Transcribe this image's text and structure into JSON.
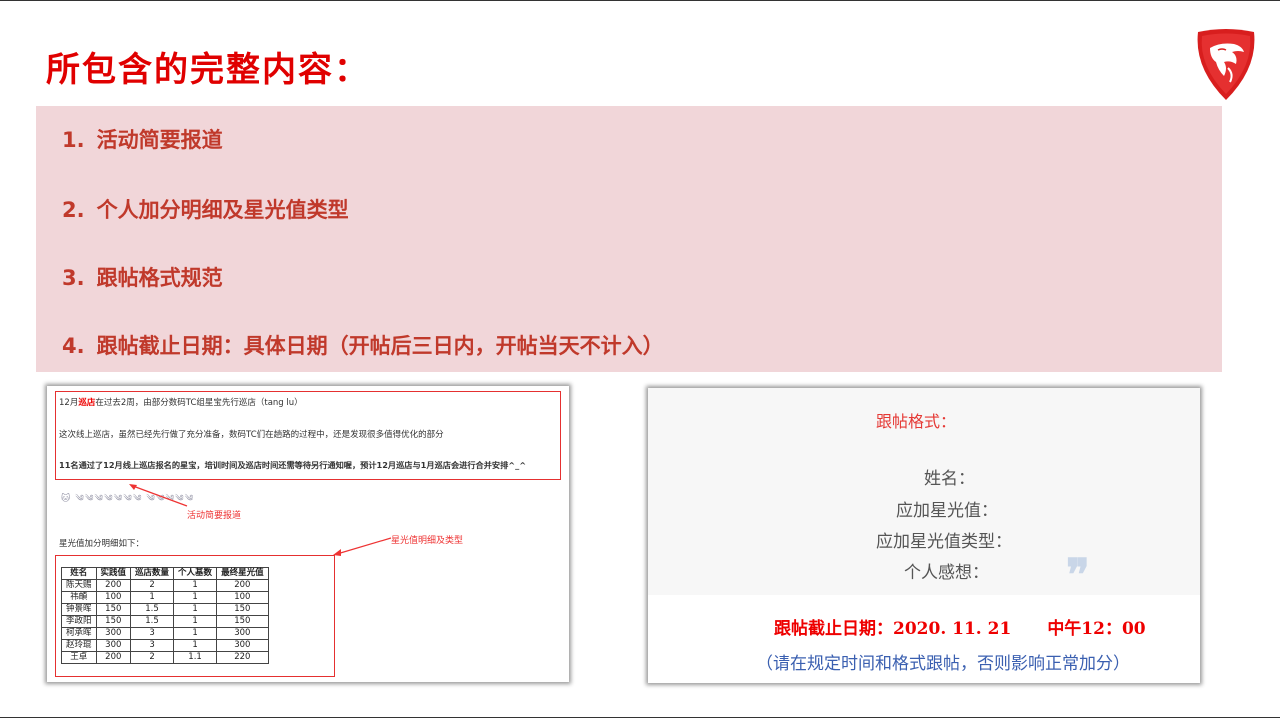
{
  "page": {
    "title": "所包含的完整内容："
  },
  "list": [
    {
      "num": "1.",
      "label": "活动简要报道"
    },
    {
      "num": "2.",
      "label": "个人加分明细及星光值类型"
    },
    {
      "num": "3.",
      "label": "跟帖格式规范"
    },
    {
      "num": "4.",
      "label": "跟帖截止日期：具体日期（开帖后三日内，开帖当天不计入）"
    }
  ],
  "report_screenshot": {
    "line1_prefix": "12月",
    "line1_highlight": "巡店",
    "line1_rest": "在过去2周，由部分数码TC组星宝先行巡店（tang lu）",
    "line2": "这次线上巡店，虽然已经先行做了充分准备，数码TC们在趟路的过程中，还是发现很多值得优化的部分",
    "line3": "11名通过了12月线上巡店报名的星宝，培训时间及巡店时间还需等待另行通知喔，预计12月巡店与1月巡店会进行合并安排^_^",
    "emoji_row": "🐱 ༄༄༄༄༄༄༄ ༄༄༄༄༄",
    "annotation_report": "活动简要报道",
    "annotation_stars": "星光值明细及类型",
    "table_intro": "星光值加分明细如下：",
    "table_headers": [
      "姓名",
      "实践值",
      "巡店数量",
      "个人基数",
      "最终星光值"
    ],
    "table_rows": [
      [
        "陈天赐",
        "200",
        "2",
        "1",
        "200"
      ],
      [
        "祎頔",
        "100",
        "1",
        "1",
        "100"
      ],
      [
        "钟景晖",
        "150",
        "1.5",
        "1",
        "150"
      ],
      [
        "李政阳",
        "150",
        "1.5",
        "1",
        "150"
      ],
      [
        "柯承晖",
        "300",
        "3",
        "1",
        "300"
      ],
      [
        "赵玲琨",
        "300",
        "3",
        "1",
        "300"
      ],
      [
        "王卓",
        "200",
        "2",
        "1.1",
        "220"
      ]
    ]
  },
  "format_screenshot": {
    "title": "跟帖格式：",
    "fields": [
      "姓名：",
      "应加星光值：",
      "应加星光值类型：",
      "个人感想："
    ],
    "quote": "❞",
    "deadline_label": "跟帖截止日期：2020. 11. 21",
    "deadline_time": "中午12：00",
    "note": "（请在规定时间和格式跟帖，否则影响正常加分）"
  },
  "colors": {
    "accent": "#e00000",
    "panel": "#f1d6d9",
    "list_text": "#c0392b",
    "note_blue": "#3a5fb0"
  },
  "icons": {
    "logo": "msi-dragon-shield-logo"
  }
}
